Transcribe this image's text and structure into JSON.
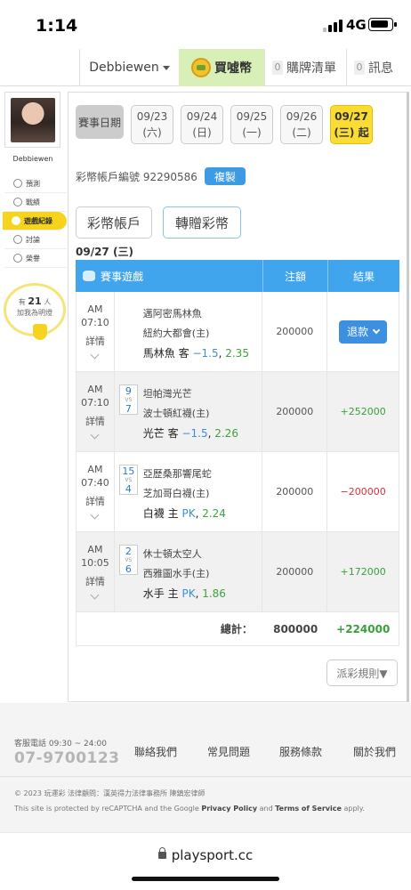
{
  "status_bar": {
    "time": "1:14",
    "network": "4G"
  },
  "header": {
    "user": "Debbiewen",
    "buy_label": "買噓幣",
    "cart_count": "0",
    "cart_label": "購牌清單",
    "msg_count": "0",
    "msg_label": "訊息"
  },
  "sidebar": {
    "username": "Debbiewen",
    "items": [
      {
        "label": "預測"
      },
      {
        "label": "戰績"
      },
      {
        "label": "遊戲紀錄"
      },
      {
        "label": "討論"
      },
      {
        "label": "榮譽"
      }
    ],
    "bulb_prefix": "有",
    "bulb_count": "21",
    "bulb_unit": "人",
    "bulb_text": "加我為明燈"
  },
  "dates": {
    "label": "賽事日期",
    "items": [
      {
        "date": "09/23",
        "day": "(六)"
      },
      {
        "date": "09/24",
        "day": "(日)"
      },
      {
        "date": "09/25",
        "day": "(一)"
      },
      {
        "date": "09/26",
        "day": "(二)"
      },
      {
        "date": "09/27",
        "day": "(三) 起"
      }
    ]
  },
  "account": {
    "label": "彩幣帳戶編號",
    "number": "92290586",
    "copy_label": "複製",
    "tab_account": "彩幣帳戶",
    "tab_transfer": "轉贈彩幣"
  },
  "selected_date": "09/27 (三)",
  "table": {
    "col_game": "賽事遊戲",
    "col_amount": "注額",
    "col_result": "結果",
    "rows": [
      {
        "ampm": "AM",
        "time": "07:10",
        "detail": "詳情",
        "score_a": "",
        "score_b": "",
        "away": "邁阿密馬林魚",
        "home": "紐約大都會(主)",
        "pick": "馬林魚 客",
        "line": "−1.5",
        "odds": "2.35",
        "amount": "200000",
        "result": "退款"
      },
      {
        "ampm": "AM",
        "time": "07:10",
        "detail": "詳情",
        "score_a": "9",
        "score_b": "7",
        "away": "坦帕灣光芒",
        "home": "波士頓紅襪(主)",
        "pick": "光芒 客",
        "line": "−1.5",
        "odds": "2.26",
        "amount": "200000",
        "result": "+252000"
      },
      {
        "ampm": "AM",
        "time": "07:40",
        "detail": "詳情",
        "score_a": "15",
        "score_b": "4",
        "away": "亞歷桑那響尾蛇",
        "home": "芝加哥白襪(主)",
        "pick": "白襪 主",
        "line": "PK",
        "odds": "2.24",
        "amount": "200000",
        "result": "−200000"
      },
      {
        "ampm": "AM",
        "time": "10:05",
        "detail": "詳情",
        "score_a": "2",
        "score_b": "6",
        "away": "休士頓太空人",
        "home": "西雅圖水手(主)",
        "pick": "水手 主",
        "line": "PK",
        "odds": "1.86",
        "amount": "200000",
        "result": "+172000"
      }
    ],
    "vs": "VS",
    "total_label": "總計：",
    "total_amount": "800000",
    "total_result": "+224000"
  },
  "rules_label": "派彩規則▼",
  "footer": {
    "service_label": "客服電話 09:30 ~ 24:00",
    "phone": "07-9700123",
    "links": [
      "聯絡我們",
      "常見問題",
      "服務條款",
      "關於我們"
    ],
    "copyright": "© 2023 玩運彩 法律顧問：漢英得力法律事務所 陳鎮宏律師",
    "recaptcha_pre": "This site is protected by reCAPTCHA and the Google",
    "privacy": "Privacy Policy",
    "and": "and",
    "terms": "Terms of Service",
    "apply": "apply."
  },
  "url": "playsport.cc",
  "colors": {
    "accent_blue": "#41a5ed",
    "highlight_yellow": "#fadc35",
    "win_green": "#38a03a",
    "loss_red": "#d9333d"
  }
}
